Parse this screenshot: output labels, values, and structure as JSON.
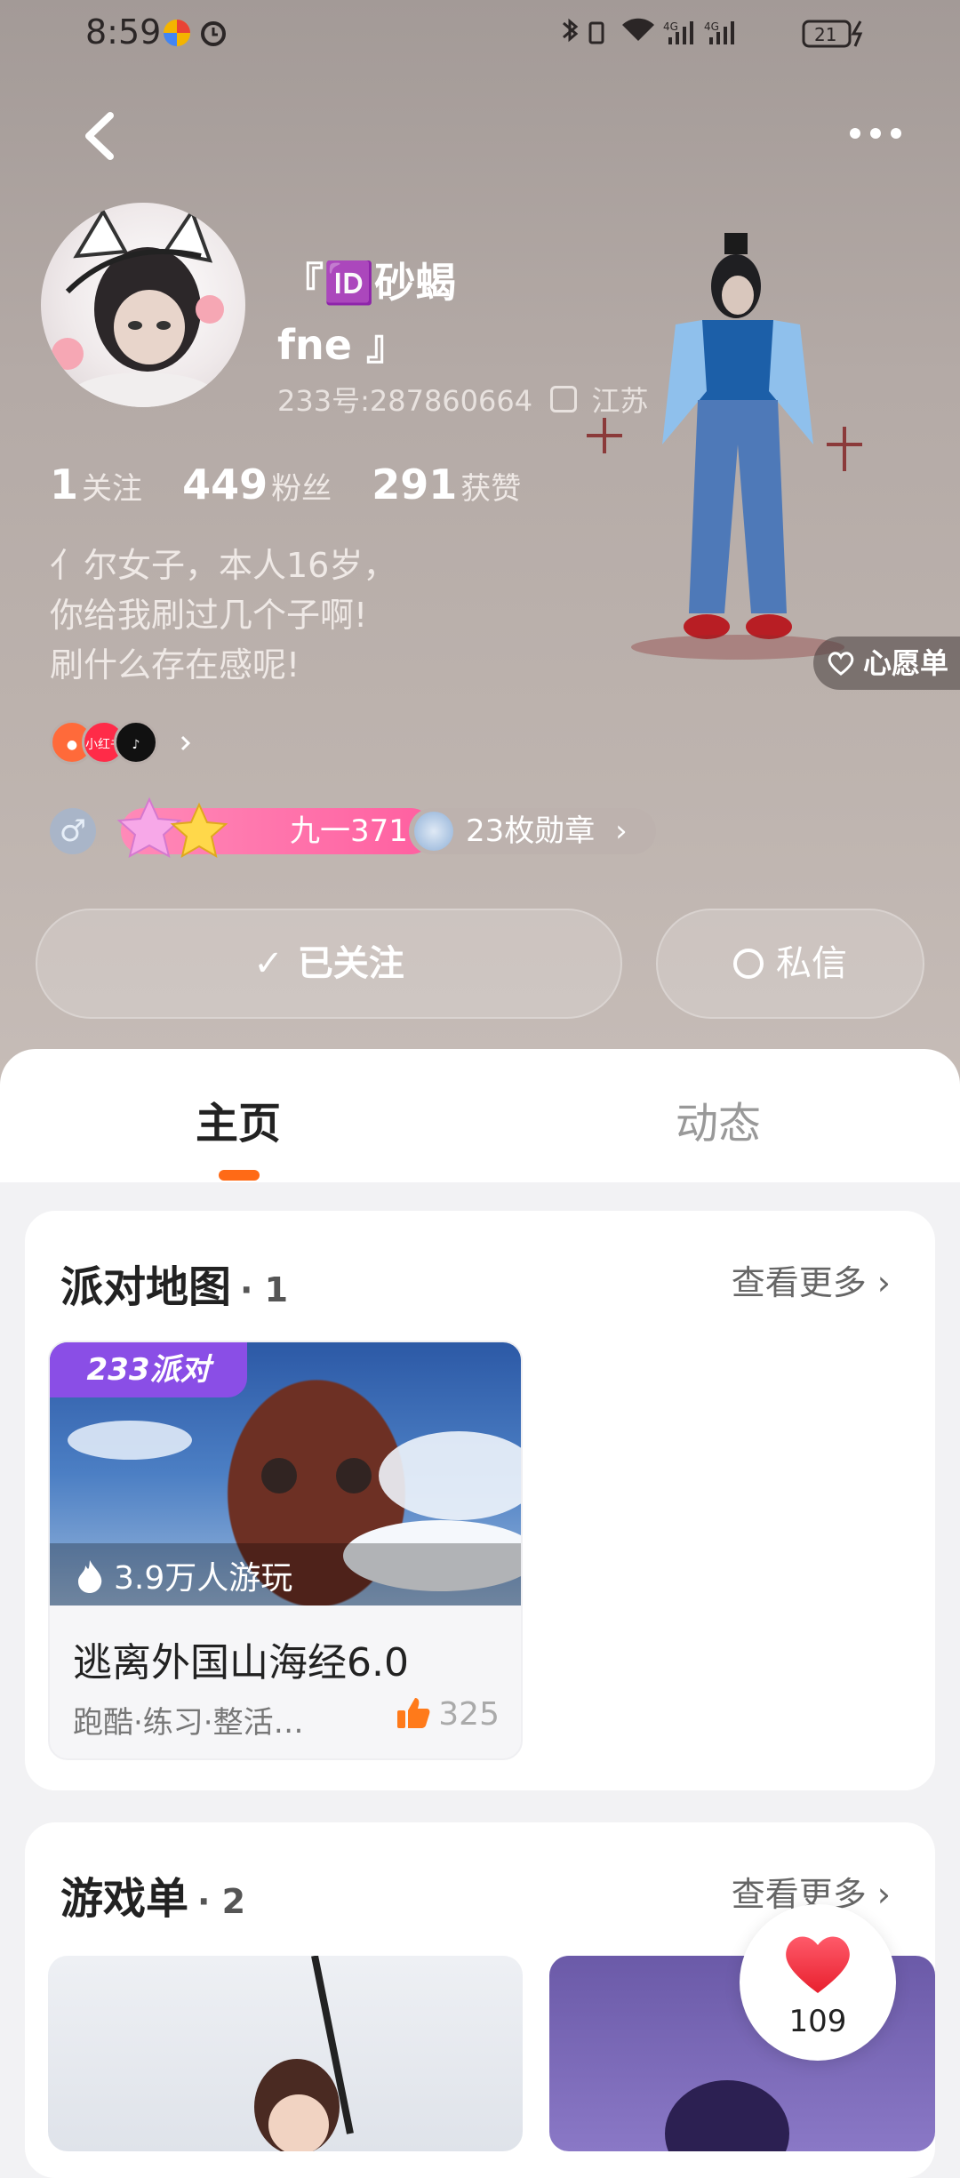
{
  "status_bar": {
    "time": "8:59",
    "battery": "21"
  },
  "profile": {
    "name_line1": "『🆔砂蝎",
    "name_line2": "fne 』",
    "id_label": "233号:287860664",
    "location": "江苏",
    "stats": [
      {
        "value": "1",
        "label": "关注"
      },
      {
        "value": "449",
        "label": "粉丝"
      },
      {
        "value": "291",
        "label": "获赞"
      }
    ],
    "bio": [
      "亻尔女子，本人16岁，",
      "你给我刷过几个子啊!",
      "刷什么存在感呢!"
    ],
    "social_icons": [
      "kuaishou-icon",
      "xiaohongshu-icon",
      "douyin-icon"
    ],
    "social_label_xhs": "小红书",
    "gender": "♂",
    "level_label": "九一371",
    "badges_label": "23枚勋章",
    "follow_label": "已关注",
    "message_label": "私信",
    "wishlist_label": "心愿单"
  },
  "tabs": [
    {
      "label": "主页",
      "active": true
    },
    {
      "label": "动态",
      "active": false
    }
  ],
  "party_maps": {
    "title": "派对地图",
    "count": "· 1",
    "see_more": "查看更多",
    "items": [
      {
        "badge": "233派对",
        "plays": "3.9万人游玩",
        "name": "逃离外国山海经6.0",
        "tags": "跑酷·练习·整活…",
        "likes": "325"
      }
    ]
  },
  "game_lists": {
    "title": "游戏单",
    "count": "· 2",
    "see_more": "查看更多"
  },
  "heart_fab": {
    "count": "109"
  },
  "colors": {
    "accent": "#ff6a16",
    "level_pink": "#ff5fa0",
    "party_purple": "#8a4ee6"
  }
}
